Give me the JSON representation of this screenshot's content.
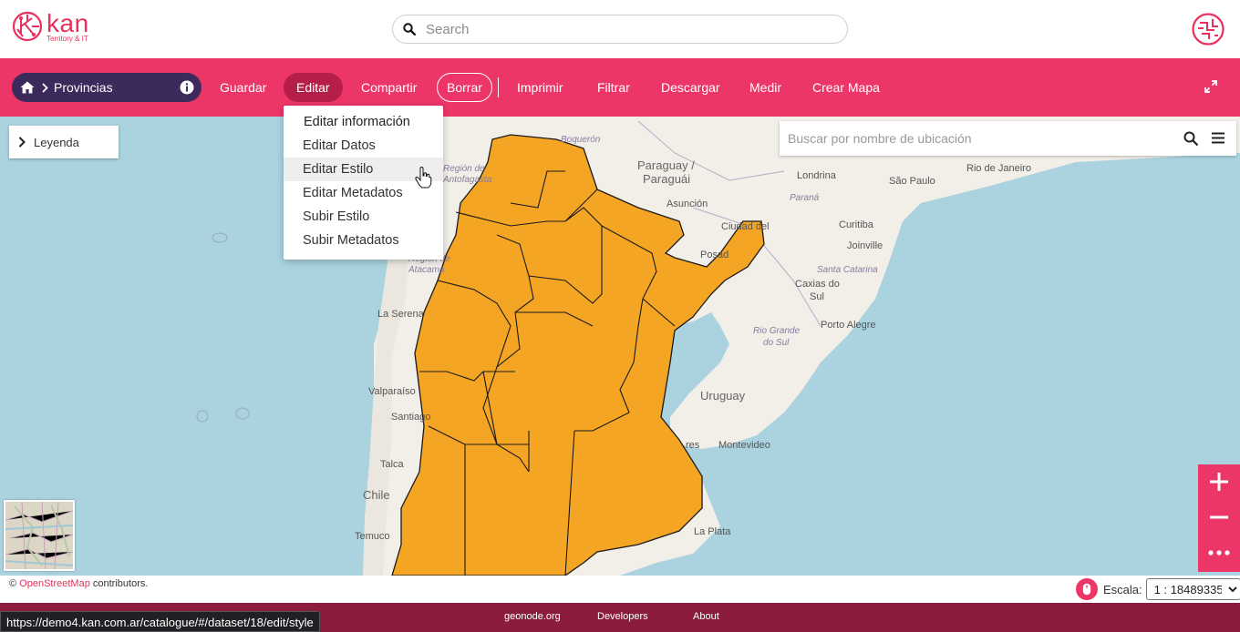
{
  "app": {
    "logo_word": "kan",
    "logo_tagline": "Territory & IT"
  },
  "search": {
    "placeholder": "Search"
  },
  "breadcrumb": {
    "label": "Provincias"
  },
  "toolbar": {
    "items": [
      "Guardar",
      "Editar",
      "Compartir",
      "Borrar",
      "Imprimir",
      "Filtrar",
      "Descargar",
      "Medir",
      "Crear Mapa"
    ],
    "accent": "#ec3667",
    "active_bg": "#b51e48",
    "crumb_bg": "#3d2a5c"
  },
  "edit_menu": {
    "items": [
      "Editar información",
      "Editar Datos",
      "Editar Estilo",
      "Editar Metadatos",
      "Subir Estilo",
      "Subir Metadatos"
    ],
    "hovered": "Editar Estilo"
  },
  "legend": {
    "label": "Leyenda"
  },
  "location_search": {
    "placeholder": "Buscar por nombre de ubicación"
  },
  "map": {
    "fill_color": "#f5a524",
    "water_color": "#aad3df",
    "labels": {
      "paraguay": "Paraguay /",
      "paraguay2": "Paraguái",
      "asuncion": "Asunción",
      "londrina": "Londrina",
      "sao_paulo": "São Paulo",
      "rio": "Rio de Janeiro",
      "parana": "Paraná",
      "curitiba": "Curitiba",
      "joinville": "Joinville",
      "santa_catarina": "Santa Catarina",
      "caxias1": "Caxias do",
      "caxias2": "Sul",
      "rio_grande1": "Rio Grande",
      "rio_grande2": "do Sul",
      "porto_alegre": "Porto Alegre",
      "uruguay": "Uruguay",
      "montevideo": "Montevideo",
      "la_serena": "La Serena",
      "valparaiso": "Valparaíso",
      "santiago": "Santiago",
      "talca": "Talca",
      "chile": "Chile",
      "temuco": "Temuco",
      "boqueron": "Boquerón",
      "antofagasta1": "Región de",
      "antofagasta2": "Antofagasta",
      "atacama1": "Región de",
      "atacama2": "Atacama",
      "ciudad": "Ciudad del",
      "posadas": "Posad",
      "la_plata": "La Plata",
      "aires": "res"
    }
  },
  "attribution": {
    "prefix": "©",
    "link": "OpenStreetMap",
    "suffix": "contributors."
  },
  "scale": {
    "label": "Escala:",
    "value": "1 : 18489335"
  },
  "footer": {
    "links": [
      "geonode.org",
      "Developers",
      "About"
    ]
  },
  "status_url": "https://demo4.kan.com.ar/catalogue/#/dataset/18/edit/style"
}
